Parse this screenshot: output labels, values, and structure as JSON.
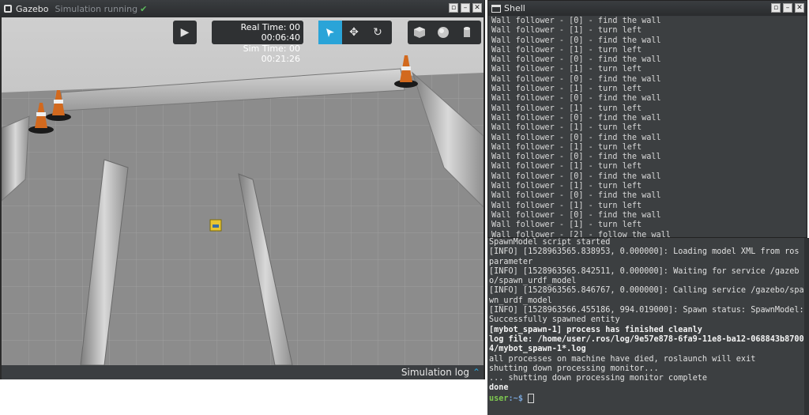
{
  "gazebo": {
    "title": "Gazebo",
    "status": "Simulation running",
    "status_icon": "check-icon",
    "real_time_label": "Real Time: 00",
    "real_time_value": "00:06:40",
    "sim_time_label": "Sim Time: 00",
    "sim_time_value": "00:21:26",
    "sim_log_label": "Simulation log",
    "tools": {
      "play": "play-icon",
      "select": "arrow-icon",
      "translate": "move-icon",
      "rotate": "rotate-icon",
      "box": "box-icon",
      "sphere": "sphere-icon",
      "cylinder": "cylinder-icon"
    },
    "colors": {
      "accent": "#2aa4d8",
      "floor": "#8a8a8a",
      "robot": "#e8c531"
    }
  },
  "shell": {
    "title": "Shell",
    "lines": [
      "Wall follower - [0] - find the wall",
      "Wall follower - [1] - turn left",
      "Wall follower - [0] - find the wall",
      "Wall follower - [1] - turn left",
      "Wall follower - [0] - find the wall",
      "Wall follower - [1] - turn left",
      "Wall follower - [0] - find the wall",
      "Wall follower - [1] - turn left",
      "Wall follower - [0] - find the wall",
      "Wall follower - [1] - turn left",
      "Wall follower - [0] - find the wall",
      "Wall follower - [1] - turn left",
      "Wall follower - [0] - find the wall",
      "Wall follower - [1] - turn left",
      "Wall follower - [0] - find the wall",
      "Wall follower - [1] - turn left",
      "Wall follower - [0] - find the wall",
      "Wall follower - [1] - turn left",
      "Wall follower - [0] - find the wall",
      "Wall follower - [1] - turn left",
      "Wall follower - [0] - find the wall",
      "Wall follower - [1] - turn left",
      "Wall follower - [2] - follow the wall"
    ]
  },
  "terminal2": {
    "lines": [
      {
        "text": "SpawnModel script started",
        "style": ""
      },
      {
        "text": "[INFO] [1528963565.838953, 0.000000]: Loading model XML from ros parameter",
        "style": ""
      },
      {
        "text": "[INFO] [1528963565.842511, 0.000000]: Waiting for service /gazebo/spawn_urdf_model",
        "style": ""
      },
      {
        "text": "[INFO] [1528963565.846767, 0.000000]: Calling service /gazebo/spawn_urdf_model",
        "style": ""
      },
      {
        "text": "[INFO] [1528963566.455186, 994.019000]: Spawn status: SpawnModel: Successfully spawned entity",
        "style": ""
      },
      {
        "text": "[mybot_spawn-1] process has finished cleanly",
        "style": "bold"
      },
      {
        "text": "log file: /home/user/.ros/log/9e57e878-6fa9-11e8-ba12-068843b87004/mybot_spawn-1*.log",
        "style": "bold"
      },
      {
        "text": "all processes on machine have died, roslaunch will exit",
        "style": ""
      },
      {
        "text": "shutting down processing monitor...",
        "style": ""
      },
      {
        "text": "... shutting down processing monitor complete",
        "style": ""
      },
      {
        "text": "done",
        "style": "bold"
      }
    ],
    "prompt_user": "user",
    "prompt_path": ":~$"
  }
}
